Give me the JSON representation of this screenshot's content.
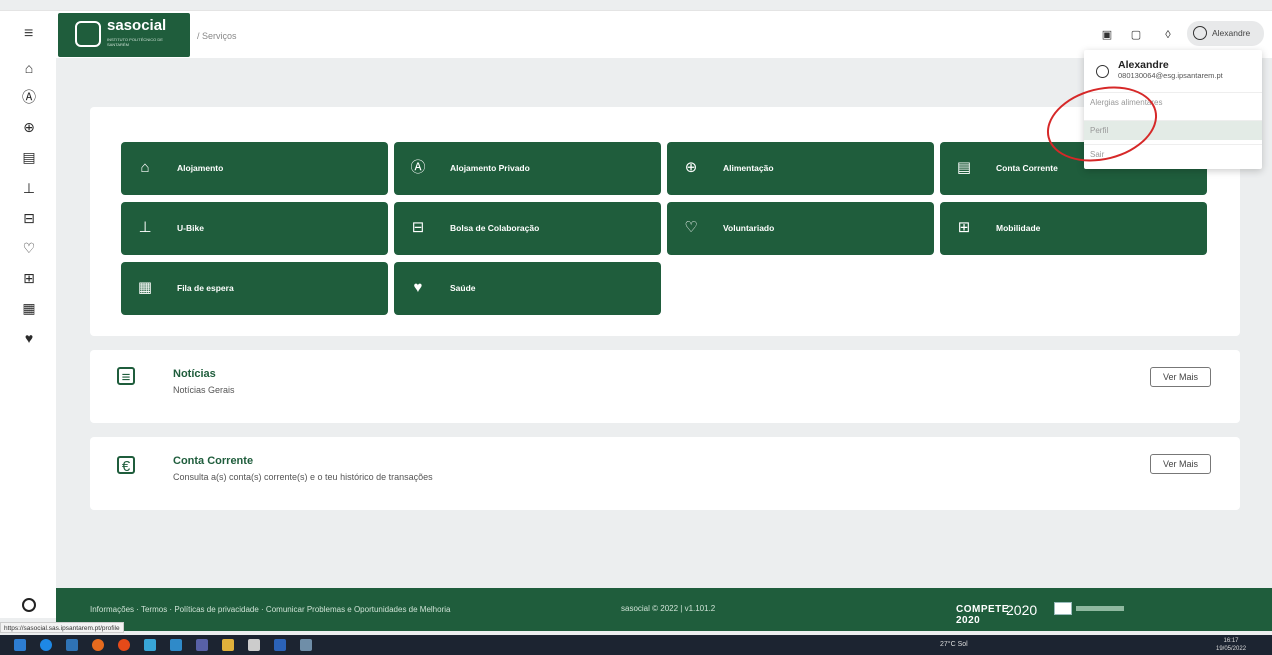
{
  "header": {
    "logo": {
      "name": "sasocial",
      "subtitle": "INSTITUTO POLITÉCNICO DE SANTARÉM"
    },
    "breadcrumb": "/ Serviços",
    "user_name": "Alexandre"
  },
  "sidebar": {
    "icons": [
      "home-icon",
      "private-housing-icon",
      "food-icon",
      "wallet-icon",
      "bike-icon",
      "briefcase-icon",
      "volunteer-icon",
      "bus-icon",
      "queue-icon",
      "health-icon"
    ]
  },
  "services": [
    {
      "label": "Alojamento",
      "icon": "home-icon"
    },
    {
      "label": "Alojamento Privado",
      "icon": "private-housing-icon"
    },
    {
      "label": "Alimentação",
      "icon": "food-icon"
    },
    {
      "label": "Conta Corrente",
      "icon": "wallet-icon"
    },
    {
      "label": "U-Bike",
      "icon": "bike-icon"
    },
    {
      "label": "Bolsa de Colaboração",
      "icon": "briefcase-icon"
    },
    {
      "label": "Voluntariado",
      "icon": "volunteer-icon"
    },
    {
      "label": "Mobilidade",
      "icon": "bus-icon"
    },
    {
      "label": "Fila de espera",
      "icon": "queue-icon"
    },
    {
      "label": "Saúde",
      "icon": "health-icon"
    }
  ],
  "news": {
    "title": "Notícias",
    "subtitle": "Notícias Gerais",
    "button": "Ver Mais"
  },
  "account": {
    "title": "Conta Corrente",
    "subtitle": "Consulta a(s) conta(s) corrente(s) e o teu histórico de transações",
    "button": "Ver Mais"
  },
  "dropdown": {
    "name": "Alexandre",
    "email": "080130064@esg.ipsantarem.pt",
    "items": [
      "Alergias alimentares",
      "Perfil",
      "Sair"
    ],
    "active_item": "Perfil"
  },
  "footer": {
    "links": "Informações · Termos · Políticas de privacidade · Comunicar Problemas e Oportunidades de Melhoria",
    "copyright": "sasocial © 2022 | v1.101.2",
    "compete": "COMPETE 2020",
    "portugal2020": "2020"
  },
  "status_url": "https://sasocial.sas.ipsantarem.pt/profile",
  "taskbar": {
    "tray": "27°C Sol",
    "time": "16:17",
    "date": "19/05/2022"
  },
  "colors": {
    "brand": "#1f5d3c",
    "background": "#eceeef",
    "highlight": "#d62828"
  }
}
